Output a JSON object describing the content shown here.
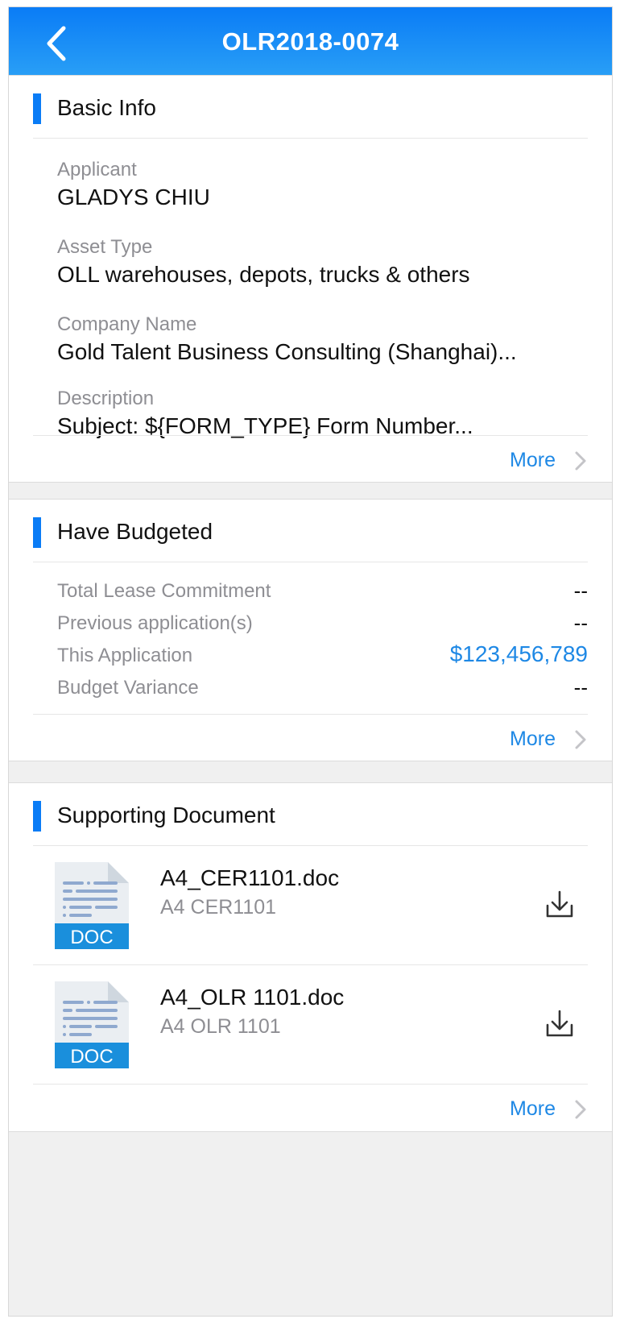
{
  "nav": {
    "title": "OLR2018-0074"
  },
  "basic_info": {
    "heading": "Basic Info",
    "fields": [
      {
        "label": "Applicant",
        "value": "GLADYS CHIU"
      },
      {
        "label": "Asset Type",
        "value": "OLL warehouses, depots, trucks & others"
      },
      {
        "label": "Company Name",
        "value": "Gold Talent Business Consulting (Shanghai)..."
      },
      {
        "label": "Description",
        "value": "Subject: ${FORM_TYPE} Form Number..."
      }
    ],
    "more": "More"
  },
  "budget": {
    "heading": "Have Budgeted",
    "rows": [
      {
        "label": "Total Lease Commitment",
        "value": "--"
      },
      {
        "label": "Previous application(s)",
        "value": "--"
      },
      {
        "label": "This Application",
        "value": "$123,456,789"
      },
      {
        "label": "Budget Variance",
        "value": "--"
      }
    ],
    "more": "More"
  },
  "documents": {
    "heading": "Supporting Document",
    "items": [
      {
        "name": "A4_CER1101.doc",
        "desc": "A4 CER1101",
        "badge": "DOC"
      },
      {
        "name": "A4_OLR 1101.doc",
        "desc": "A4 OLR 1101",
        "badge": "DOC"
      }
    ],
    "more": "More"
  },
  "colors": {
    "accent": "#0a7cf6",
    "link": "#1e88e5",
    "doc_badge": "#1a8fdc"
  },
  "icons": [
    "chevron-left-icon",
    "chevron-right-icon",
    "doc-file-icon",
    "download-icon"
  ]
}
